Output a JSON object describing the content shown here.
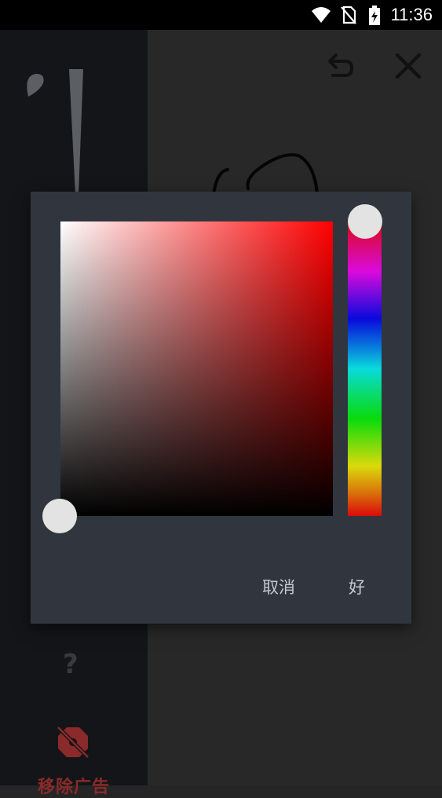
{
  "status_bar": {
    "time": "11:36",
    "icons": [
      "wifi-icon",
      "no-sim-icon",
      "battery-charging-icon"
    ]
  },
  "toolbar": {
    "icons": [
      "undo-icon",
      "close-icon"
    ]
  },
  "sidebar": {
    "icons": [
      "brush-icon",
      "help-icon"
    ],
    "remove_ad": {
      "label": "移除广告",
      "icon": "no-ads-icon",
      "color": "#8a2a2a"
    }
  },
  "color_picker": {
    "selected_hue": "#ff0000",
    "saturation": 0.0,
    "value": 0.0,
    "hue_position": 0.0,
    "cancel_label": "取消",
    "ok_label": "好"
  }
}
